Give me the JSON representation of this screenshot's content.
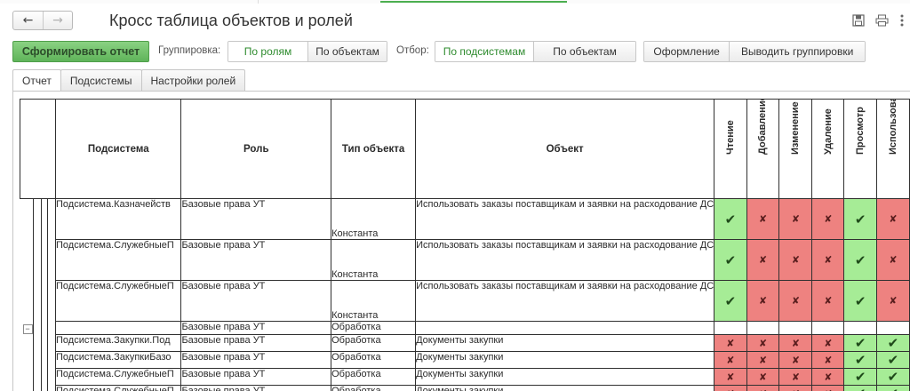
{
  "window": {
    "title": "Кросс таблица объектов и ролей",
    "nav": {
      "back_icon": "←",
      "forward_icon": "→"
    }
  },
  "toolbar": {
    "generate_label": "Сформировать отчет",
    "grouping_label": "Группировка:",
    "grouping_options": [
      "По ролям",
      "По объектам"
    ],
    "grouping_selected": "По ролям",
    "filter_label": "Отбор:",
    "filter_options": [
      "По подсистемам",
      "По объектам"
    ],
    "filter_selected": "По подсистемам",
    "design_label": "Оформление",
    "show_groups_label": "Выводить группировки"
  },
  "tabs": [
    "Отчет",
    "Подсистемы",
    "Настройки ролей"
  ],
  "active_tab": "Отчет",
  "report": {
    "columns": {
      "subsystem": "Подсистема",
      "role": "Роль",
      "object_type": "Тип объекта",
      "object": "Объект"
    },
    "rights": [
      "Чтение",
      "Добавление",
      "Изменение",
      "Удаление",
      "Просмотр",
      "Использование"
    ],
    "rows": [
      {
        "subsystem": "Подсистема.Казначейств",
        "role": "Базовые права УТ",
        "type": "Константа",
        "object": "Использовать заказы поставщикам и заявки на расходование ДС",
        "marks": [
          "y",
          "n",
          "n",
          "n",
          "y",
          "n"
        ],
        "tall": true
      },
      {
        "subsystem": "Подсистема.СлужебныеП",
        "role": "Базовые права УТ",
        "type": "Константа",
        "object": "Использовать заказы поставщикам и заявки на расходование ДС",
        "marks": [
          "y",
          "n",
          "n",
          "n",
          "y",
          "n"
        ],
        "tall": true
      },
      {
        "subsystem": "Подсистема.СлужебныеП",
        "role": "Базовые права УТ",
        "type": "Константа",
        "object": "Использовать заказы поставщикам и заявки на расходование ДС",
        "marks": [
          "y",
          "n",
          "n",
          "n",
          "y",
          "n"
        ],
        "tall": true
      },
      {
        "subsystem": "",
        "role": "Базовые права УТ",
        "type": "Обработка",
        "object": "",
        "marks": [
          "e",
          "e",
          "e",
          "e",
          "e",
          "e"
        ],
        "tall": false,
        "group": true
      },
      {
        "subsystem": "Подсистема.Закупки.Под",
        "role": "Базовые права УТ",
        "type": "Обработка",
        "object": "Документы закупки",
        "marks": [
          "n",
          "n",
          "n",
          "n",
          "y",
          "y"
        ],
        "tall": false
      },
      {
        "subsystem": "Подсистема.ЗакупкиБазо",
        "role": "Базовые права УТ",
        "type": "Обработка",
        "object": "Документы закупки",
        "marks": [
          "n",
          "n",
          "n",
          "n",
          "y",
          "y"
        ],
        "tall": false
      },
      {
        "subsystem": "Подсистема.СлужебныеП",
        "role": "Базовые права УТ",
        "type": "Обработка",
        "object": "Документы закупки",
        "marks": [
          "n",
          "n",
          "n",
          "n",
          "y",
          "y"
        ],
        "tall": false
      },
      {
        "subsystem": "Подсистема.СлужебныеП",
        "role": "Базовые права УТ",
        "type": "Обработка",
        "object": "Документы закупки",
        "marks": [
          "n",
          "n",
          "n",
          "n",
          "y",
          "y"
        ],
        "tall": false
      }
    ],
    "mark_glyphs": {
      "y": "✔",
      "n": "✘",
      "e": ""
    },
    "colors": {
      "allowed": "#a6ec96",
      "denied": "#ee8280"
    }
  }
}
